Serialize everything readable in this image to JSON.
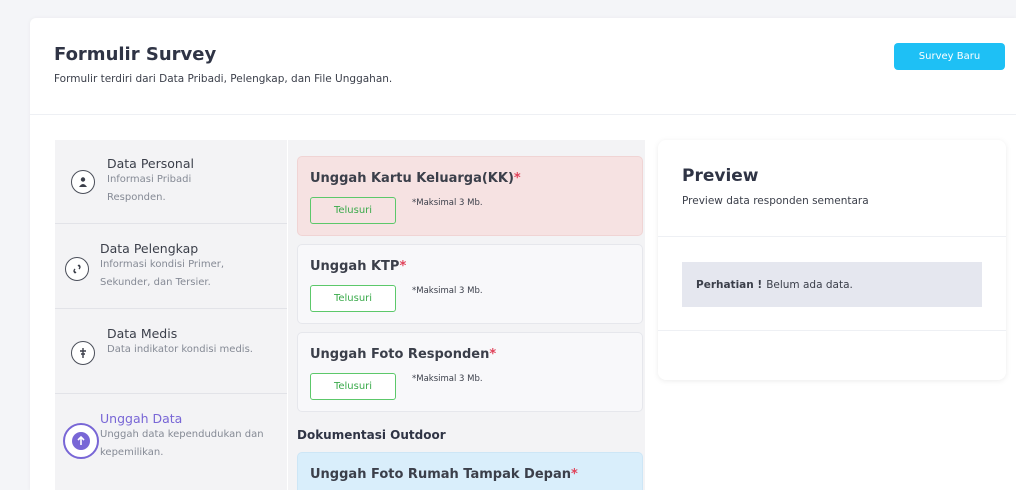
{
  "header": {
    "title": "Formulir Survey",
    "subtitle": "Formulir terdiri dari Data Pribadi, Pelengkap, dan File Unggahan.",
    "new_button": "Survey Baru"
  },
  "steps": [
    {
      "title": "Data Personal",
      "desc": "Informasi Pribadi Responden.",
      "icon": "person-icon"
    },
    {
      "title": "Data Pelengkap",
      "desc": "Informasi kondisi Primer, Sekunder, dan Tersier.",
      "icon": "link-icon"
    },
    {
      "title": "Data Medis",
      "desc": "Data indikator kondisi medis.",
      "icon": "medical-icon"
    },
    {
      "title": "Unggah Data",
      "desc": "Unggah data kependudukan dan kepemilikan.",
      "icon": "upload-icon"
    }
  ],
  "uploads": [
    {
      "title": "Unggah Kartu Keluarga(KK)",
      "required": "*",
      "browse": "Telusuri",
      "hint": "*Maksimal 3 Mb."
    },
    {
      "title": "Unggah KTP",
      "required": "*",
      "browse": "Telusuri",
      "hint": "*Maksimal 3 Mb."
    },
    {
      "title": "Unggah Foto Responden",
      "required": "*",
      "browse": "Telusuri",
      "hint": "*Maksimal 3 Mb."
    }
  ],
  "outdoor": {
    "section": "Dokumentasi Outdoor",
    "title": "Unggah Foto Rumah Tampak Depan",
    "required": "*"
  },
  "preview": {
    "title": "Preview",
    "subtitle": "Preview data responden sementara",
    "alert_bold": "Perhatian !",
    "alert_text": "Belum ada data."
  },
  "colors": {
    "accent": "#1ec0f5",
    "active_step": "#7866d6",
    "required": "#e0435a",
    "browse": "#3aaa4b"
  }
}
